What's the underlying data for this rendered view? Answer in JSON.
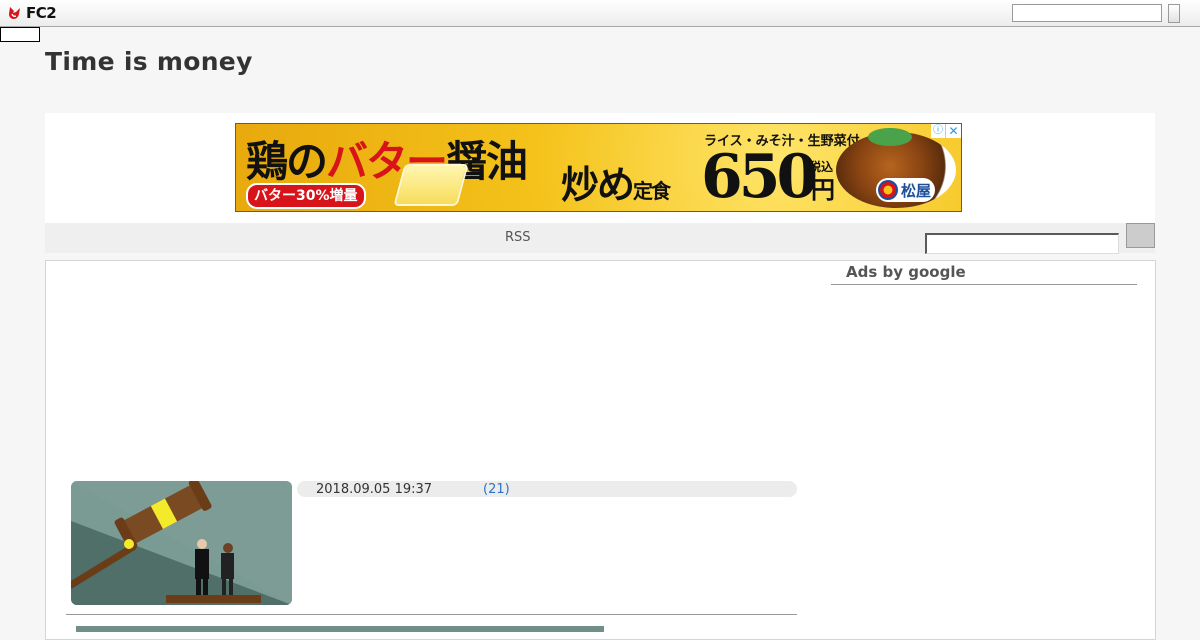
{
  "header": {
    "logo_text": "FC2",
    "search_value": "",
    "skip_box": ""
  },
  "blog": {
    "title": "Time is money"
  },
  "ad_banner": {
    "headline_part1": "鶏の",
    "headline_red": "バター",
    "headline_part2": "醤油",
    "dish": "炒め",
    "dish_suffix": "定食",
    "price": "650",
    "currency": "円",
    "tax_label": "税込",
    "side_items": "ライス・みそ汁・生野菜付",
    "promo_pill": "バター30%増量",
    "brand": "松屋",
    "info_icon": "ⓘ",
    "close_icon": "✕"
  },
  "nav": {
    "rss_label": "RSS",
    "search_value": ""
  },
  "sidebar": {
    "heading": "Ads by google"
  },
  "post": {
    "date": "2018.09.05 19:37",
    "comment_count": "(21)",
    "thumbnail_icon": "gavel-and-two-figures"
  },
  "colors": {
    "topbar": "#ececec",
    "link": "#2b73c9",
    "ad_red": "#d7141a",
    "ad_yellow": "#f4c21a"
  }
}
